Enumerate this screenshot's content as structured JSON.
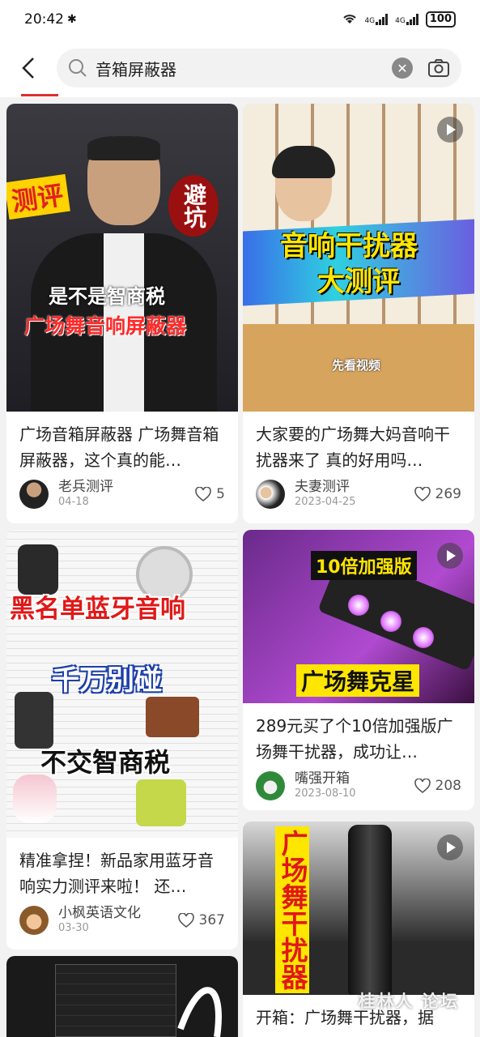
{
  "status_bar": {
    "time": "20:42",
    "network": "4G",
    "network2": "4G",
    "battery": "100"
  },
  "search": {
    "query": "音箱屏蔽器"
  },
  "cards": [
    {
      "title": "广场音箱屏蔽器 广场舞音箱屏蔽器，这个真的能…",
      "author": "老兵测评",
      "date": "04-18",
      "likes": "5",
      "overlay": [
        "测评",
        "避坑",
        "是不是智商税",
        "广场舞音响屏蔽器"
      ]
    },
    {
      "title": "大家要的广场舞大妈音响干扰器来了 真的好用吗…",
      "author": "夫妻测评",
      "date": "2023-04-25",
      "likes": "269",
      "overlay": [
        "音响干扰器",
        "大测评",
        "先看视频"
      ]
    },
    {
      "title": "精准拿捏！新品家用蓝牙音响实力测评来啦！ 还…",
      "author": "小枫英语文化",
      "date": "03-30",
      "likes": "367",
      "overlay": [
        "黑名单蓝牙音响",
        "千万别碰",
        "不交智商税"
      ]
    },
    {
      "title": "289元买了个10倍加强版广场舞干扰器，成功让…",
      "author": "嘴强开箱",
      "date": "2023-08-10",
      "likes": "208",
      "overlay": [
        "10倍加强版",
        "广场舞克星"
      ]
    },
    {
      "title": "开箱：广场舞干扰器，据",
      "overlay": [
        "广场舞干扰器"
      ]
    }
  ],
  "watermark": "桂林人 论坛",
  "colors": {
    "accent": "#e02e2e",
    "background": "#f2f2f2"
  }
}
